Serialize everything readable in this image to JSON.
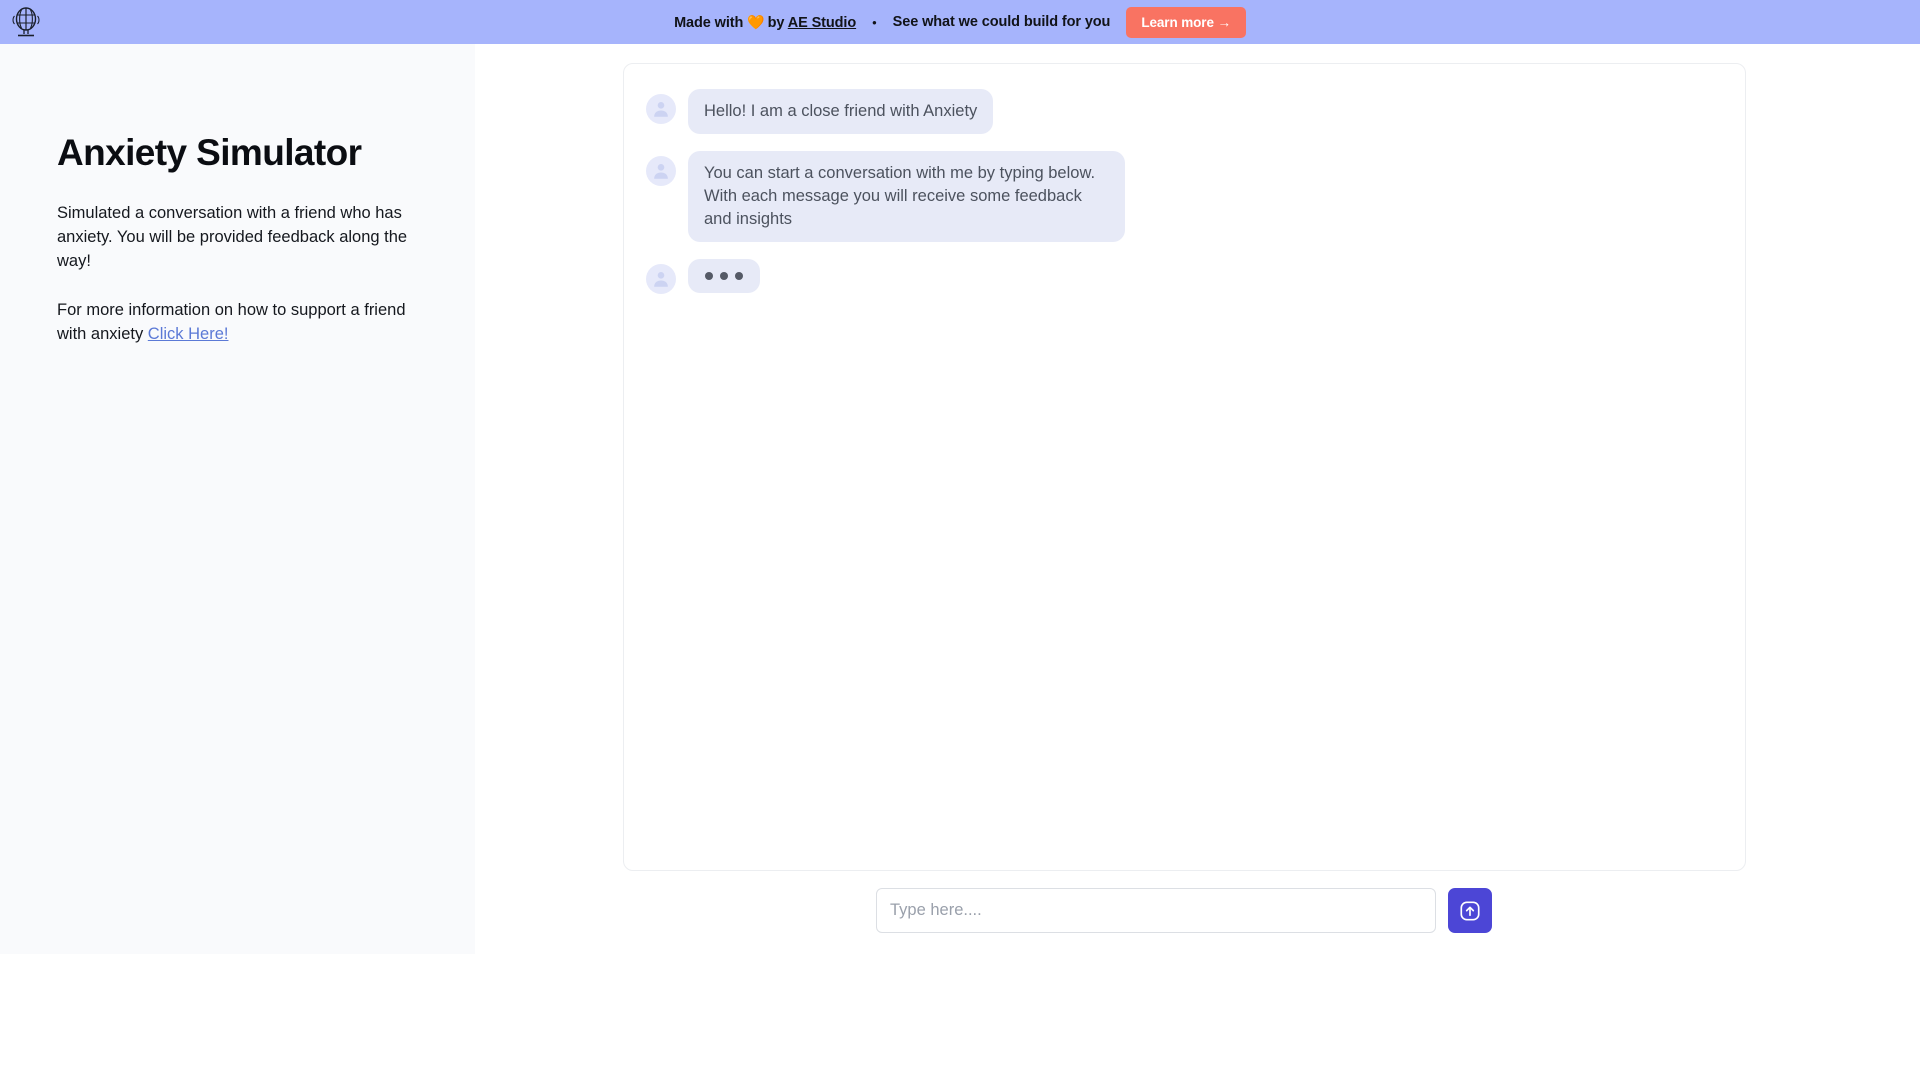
{
  "banner": {
    "made_with_prefix": "Made with",
    "heart_icon": "heart-icon",
    "by_text": "by",
    "studio_name": "AE Studio",
    "separator": "•",
    "tagline": "See what we could build for you",
    "cta_label": "Learn more →",
    "logo_icon": "brain-logo-icon",
    "background_color": "#a6b4fc",
    "cta_color": "#f97362"
  },
  "sidebar": {
    "title": "Anxiety Simulator",
    "description": "Simulated a conversation with a friend who has anxiety. You will be provided feedback along the way!",
    "support_text_prefix": "For more information on how to support a friend with anxiety ",
    "support_link_label": "Click Here!",
    "background_color": "#f9fafc",
    "link_color": "#5b79d6"
  },
  "chat": {
    "messages": [
      {
        "avatar_icon": "user-avatar-icon",
        "text": "Hello! I am a close friend with Anxiety",
        "type": "short"
      },
      {
        "avatar_icon": "user-avatar-icon",
        "text": "You can start a conversation with me by typing below. With each message you will receive some feedback and insights",
        "type": "long"
      }
    ],
    "typing_indicator": {
      "avatar_icon": "user-avatar-icon",
      "dot_count": 3,
      "dot_color": "#555a66"
    },
    "bubble_color": "#e7eaf7",
    "bubble_text_color": "#4c525e"
  },
  "composer": {
    "input_value": "",
    "input_placeholder": "Type here....",
    "send_icon": "arrow-up-circle-icon",
    "send_button_color": "#4c46d6"
  }
}
